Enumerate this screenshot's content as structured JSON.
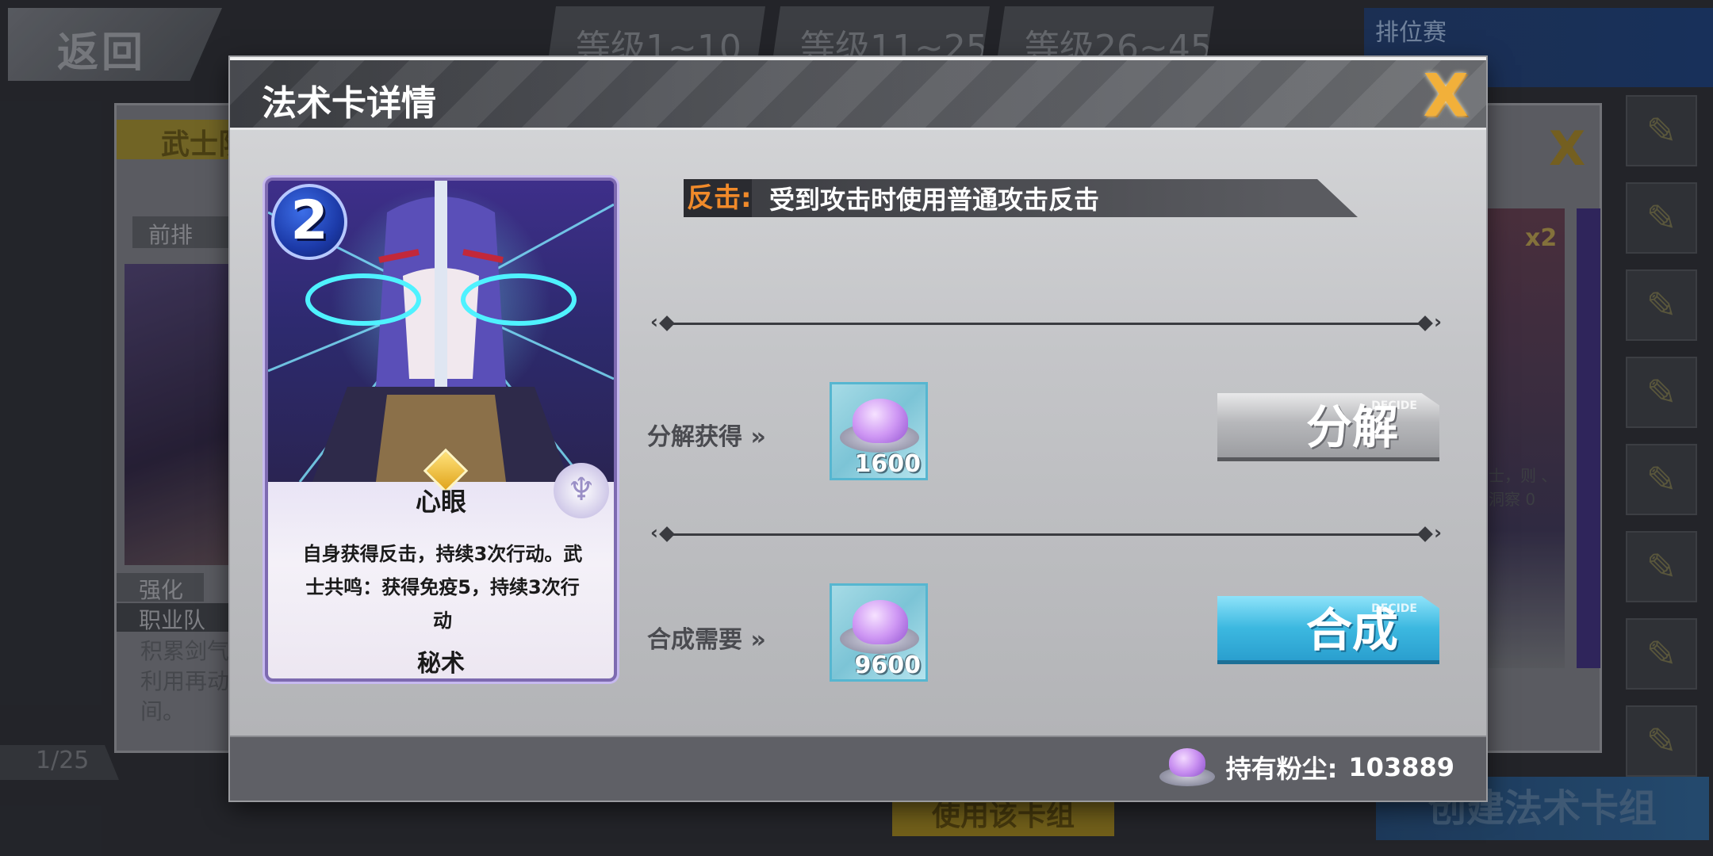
{
  "background": {
    "back_label": "返回",
    "level_tabs": [
      "等级1~10",
      "等级11~25",
      "等级26~45"
    ],
    "ranked_label": "排位赛",
    "left_panel": {
      "warrior_tag": "武士队",
      "front_row": "前排",
      "enhance": "强化",
      "job_team": "职业队",
      "desc": "积累剑气 利用再动 间。"
    },
    "right_panel": {
      "multiplier": "x2",
      "desc": "士，则 、洞察 0"
    },
    "page_indicator": "1/25",
    "use_deck_label": "使用该卡组",
    "create_deck_label": "创建法术卡组"
  },
  "modal": {
    "title": "法术卡详情",
    "close_glyph": "X",
    "card": {
      "cost": "2",
      "name": "心眼",
      "description": "自身获得反击，持续3次行动。武士共鸣：获得免疫5，持续3次行动",
      "type": "秘术"
    },
    "effect": {
      "keyword": "反击:",
      "text": "受到攻击时使用普通攻击反击"
    },
    "decompose": {
      "label": "分解获得",
      "amount": "1600",
      "button_label": "分解",
      "button_tag": "DECIDE"
    },
    "compose": {
      "label": "合成需要",
      "amount": "9600",
      "button_label": "合成",
      "button_tag": "DECIDE"
    },
    "footer": {
      "dust_label": "持有粉尘:",
      "dust_value": "103889"
    }
  },
  "colors": {
    "keyword_orange": "#f08a2a",
    "close_gold": "#f2b03a",
    "compose_blue": "#3cb8e0"
  }
}
